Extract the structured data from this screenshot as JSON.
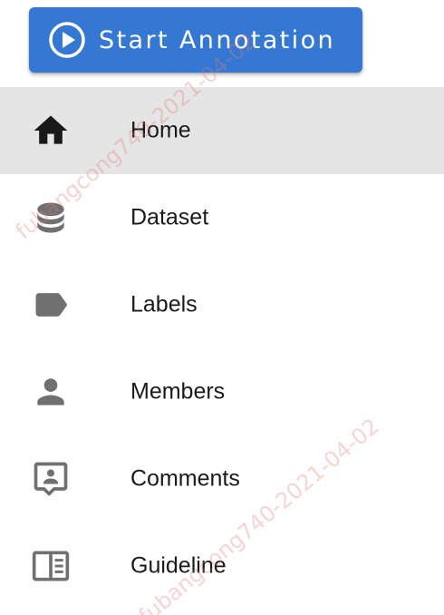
{
  "start_button": {
    "label": "Start Annotation",
    "icon": "play-circle-icon",
    "color": "#3478d4"
  },
  "nav": {
    "active_color": "#e5e5e5",
    "items": [
      {
        "label": "Home",
        "icon": "home-icon",
        "active": true
      },
      {
        "label": "Dataset",
        "icon": "database-icon",
        "active": false
      },
      {
        "label": "Labels",
        "icon": "label-tag-icon",
        "active": false
      },
      {
        "label": "Members",
        "icon": "person-icon",
        "active": false
      },
      {
        "label": "Comments",
        "icon": "comment-account-icon",
        "active": false
      },
      {
        "label": "Guideline",
        "icon": "book-open-icon",
        "active": false
      }
    ]
  },
  "watermark": {
    "line1": "fubangcong740-2021-04-02",
    "line2": "fubangcong740-2021-04-02"
  }
}
